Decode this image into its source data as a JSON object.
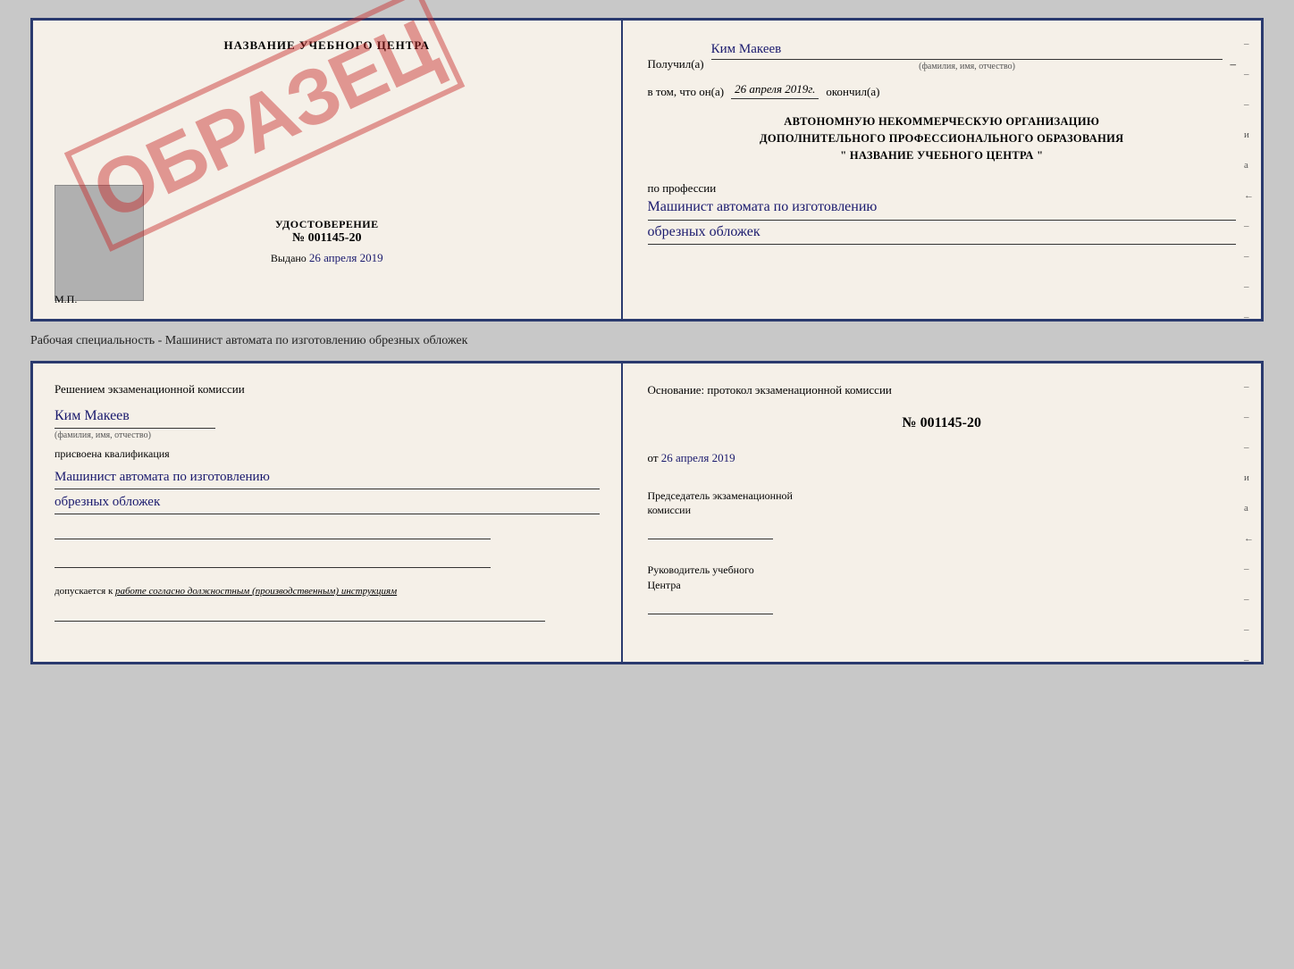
{
  "topCert": {
    "left": {
      "title": "НАЗВАНИЕ УЧЕБНОГО ЦЕНТРА",
      "udostoverenie_label": "УДОСТОВЕРЕНИЕ",
      "number": "№ 001145-20",
      "vydano_label": "Выдано",
      "vydano_date": "26 апреля 2019",
      "mp_label": "М.П.",
      "stamp_text": "ОБРАЗЕЦ"
    },
    "right": {
      "poluchil_label": "Получил(а)",
      "recipient_name": "Ким Макеев",
      "fio_sublabel": "(фамилия, имя, отчество)",
      "vtom_label": "в том, что он(а)",
      "date_value": "26 апреля 2019г.",
      "okonchil_label": "окончил(а)",
      "org_line1": "АВТОНОМНУЮ НЕКОММЕРЧЕСКУЮ ОРГАНИЗАЦИЮ",
      "org_line2": "ДОПОЛНИТЕЛЬНОГО ПРОФЕССИОНАЛЬНОГО ОБРАЗОВАНИЯ",
      "org_line3": "\"  НАЗВАНИЕ УЧЕБНОГО ЦЕНТРА  \"",
      "profession_label": "по профессии",
      "profession_value1": "Машинист автомата по изготовлению",
      "profession_value2": "обрезных обложек"
    }
  },
  "separator": {
    "text": "Рабочая специальность - Машинист автомата по изготовлению обрезных обложек"
  },
  "bottomCert": {
    "left": {
      "decision_text": "Решением экзаменационной комиссии",
      "name": "Ким Макеев",
      "fio_sublabel": "(фамилия, имя, отчество)",
      "assigned_text": "присвоена квалификация",
      "qual_value1": "Машинист автомата по изготовлению",
      "qual_value2": "обрезных обложек",
      "допускается_label": "допускается к",
      "допускается_value": "работе согласно должностным (производственным) инструкциям"
    },
    "right": {
      "osnование_label": "Основание: протокол экзаменационной комиссии",
      "protocol_number": "№  001145-20",
      "protocol_date_prefix": "от",
      "protocol_date": "26 апреля 2019",
      "chairman_label1": "Председатель экзаменационной",
      "chairman_label2": "комиссии",
      "director_label1": "Руководитель учебного",
      "director_label2": "Центра"
    }
  },
  "edgeMarks": {
    "dashes": [
      "-",
      "-",
      "-",
      "и",
      "а",
      "←",
      "-",
      "-",
      "-",
      "-"
    ]
  }
}
